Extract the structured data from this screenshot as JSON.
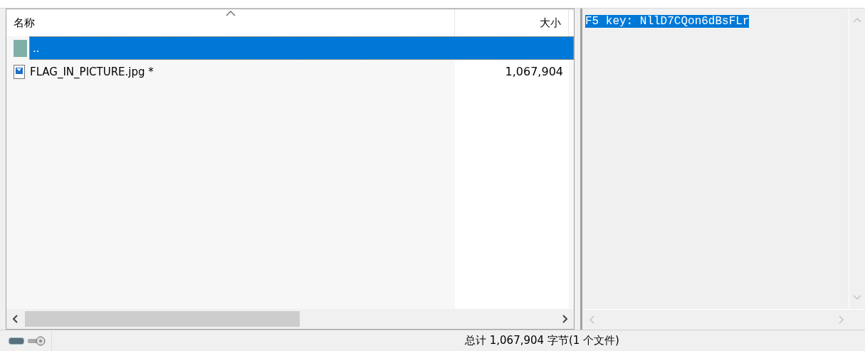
{
  "file_list": {
    "columns": [
      {
        "label": "名称",
        "sorted": true
      },
      {
        "label": "大小",
        "sorted": false
      }
    ],
    "rows": [
      {
        "kind": "parent",
        "name": "..",
        "size": "",
        "selected": true
      },
      {
        "kind": "image",
        "name": "FLAG_IN_PICTURE.jpg *",
        "size": "1,067,904",
        "selected": false
      }
    ]
  },
  "preview": {
    "text": "F5 key: NllD7CQon6dBsFLr",
    "highlighted": true
  },
  "status_bar": {
    "summary": "总计 1,067,904 字节(1 个文件)"
  }
}
